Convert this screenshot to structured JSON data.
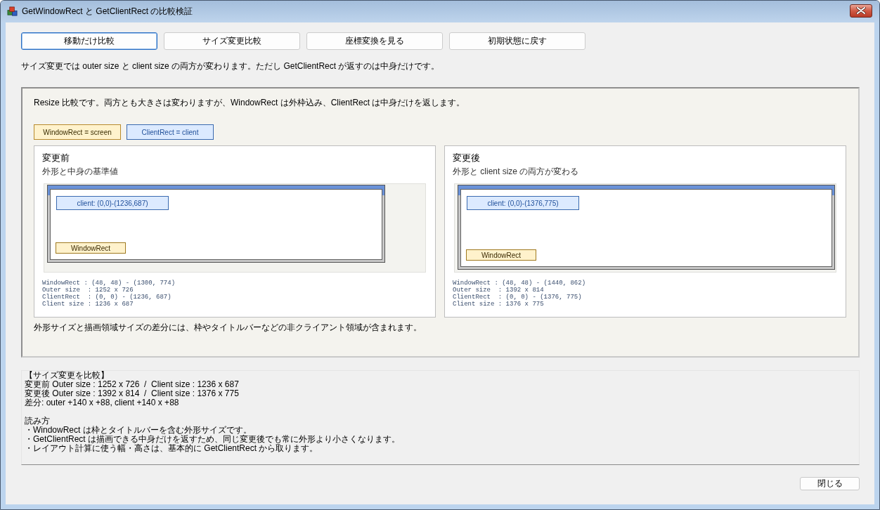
{
  "window": {
    "title": "GetWindowRect と GetClientRect の比較検証"
  },
  "toolbar_buttons": [
    {
      "label": "移動だけ比較",
      "selected": true
    },
    {
      "label": "サイズ変更比較",
      "selected": false
    },
    {
      "label": "座標変換を見る",
      "selected": false
    },
    {
      "label": "初期状態に戻す",
      "selected": false
    }
  ],
  "description": "サイズ変更では outer size と client size の両方が変わります。ただし GetClientRect が返すのは中身だけです。",
  "comparison_panel": {
    "intro": "Resize 比較です。両方とも大きさは変わりますが、WindowRect は外枠込み、ClientRect は中身だけを返します。",
    "legend": [
      {
        "kind": "window",
        "label": "WindowRect = screen"
      },
      {
        "kind": "client",
        "label": "ClientRect = client"
      }
    ],
    "cards": [
      {
        "kind": "before",
        "title": "変更前",
        "subtitle": "外形と中身の基準値",
        "diagram": {
          "client_label": "client: (0,0)-(1236,687)",
          "window_label": "WindowRect"
        },
        "details": [
          "WindowRect : (48, 48) - (1300, 774)",
          "Outer size  : 1252 x 726",
          "ClientRect  : (0, 0) - (1236, 687)",
          "Client size : 1236 x 687"
        ]
      },
      {
        "kind": "after",
        "title": "変更後",
        "subtitle": "外形と client size の両方が変わる",
        "diagram": {
          "client_label": "client: (0,0)-(1376,775)",
          "window_label": "WindowRect"
        },
        "details": [
          "WindowRect : (48, 48) - (1440, 862)",
          "Outer size  : 1392 x 814",
          "ClientRect  : (0, 0) - (1376, 775)",
          "Client size : 1376 x 775"
        ]
      }
    ],
    "footnote": "外形サイズと描画領域サイズの差分には、枠やタイトルバーなどの非クライアント領域が含まれます。"
  },
  "result_log": {
    "sections": [
      {
        "lines": [
          "【サイズ変更を比較】",
          "変更前 Outer size : 1252 x 726  /  Client size : 1236 x 687",
          "変更後 Outer size : 1392 x 814  /  Client size : 1376 x 775",
          "差分: outer +140 x +88, client +140 x +88"
        ]
      },
      {
        "lines": [
          "読み方",
          "・WindowRect は枠とタイトルバーを含む外形サイズです。",
          "・GetClientRect は描画できる中身だけを返すため、同じ変更後でも常に外形より小さくなります。",
          "・レイアウト計算に使う幅・高さは、基本的に GetClientRect から取ります。"
        ]
      }
    ]
  },
  "close_button": {
    "label": "閉じる"
  }
}
